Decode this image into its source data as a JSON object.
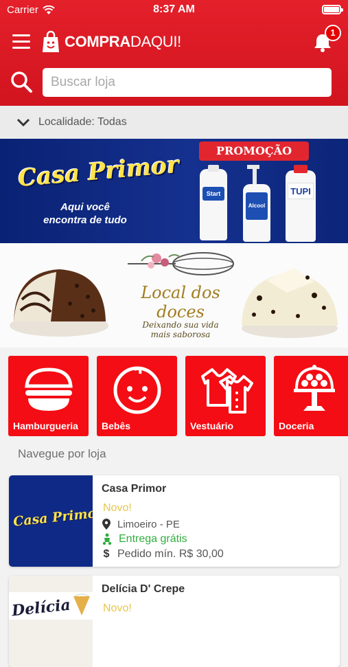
{
  "status_bar": {
    "carrier": "Carrier",
    "time": "8:37 AM"
  },
  "header": {
    "brand_bold": "COMPRA",
    "brand_light": "DAQUI!",
    "notification_count": "1"
  },
  "search": {
    "placeholder": "Buscar loja"
  },
  "location": {
    "label": "Localidade: Todas"
  },
  "banners": [
    {
      "brand": "Casa Primor",
      "tagline_1": "Aqui você",
      "tagline_2": "encontra de tudo",
      "promo": "PROMOÇÃO",
      "products": [
        "Start",
        "Alcool",
        "TUPI"
      ]
    },
    {
      "title": "Local dos doces",
      "subtitle_1": "Deixando sua vida",
      "subtitle_2": "mais saborosa"
    }
  ],
  "categories": [
    {
      "label": "Hamburgueria",
      "icon": "burger-icon"
    },
    {
      "label": "Bebês",
      "icon": "baby-face-icon"
    },
    {
      "label": "Vestuário",
      "icon": "clothes-icon"
    },
    {
      "label": "Doceria",
      "icon": "cake-stand-icon"
    }
  ],
  "section_title": "Navegue por loja",
  "stores": [
    {
      "name": "Casa Primor",
      "badge": "Novo!",
      "location": "Limoeiro - PE",
      "delivery": "Entrega grátis",
      "min_order": "Pedido mín. R$ 30,00",
      "thumb_text": "Casa Primor"
    },
    {
      "name": "Delícia D' Crepe",
      "badge": "Novo!",
      "thumb_text": "Delícia"
    }
  ],
  "colors": {
    "primary": "#e4202b",
    "category_bg": "#f40d14",
    "new_badge": "#e6c64d",
    "free_delivery": "#2fae3c"
  }
}
